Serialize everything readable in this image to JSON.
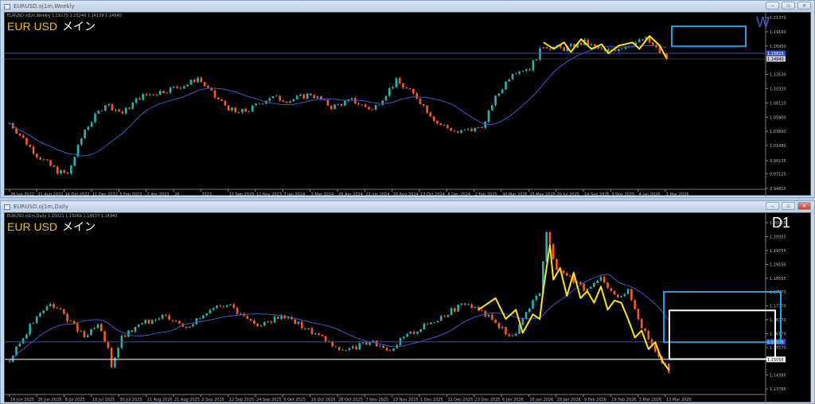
{
  "weekly": {
    "window_title": "EURUSD.oj1m,Weekly",
    "info": "EURUSD.oj1m,Weekly  1.16175 1.15248 1.14139 1.14940",
    "symbol": "EUR USD",
    "label_jp": "メイン",
    "timeframe": "W",
    "price_ticks": [
      "1.21370",
      "1.19160",
      "1.16950",
      "1.12530",
      "1.10320",
      "1.08110",
      "1.05900",
      "1.03690",
      "1.01480",
      "0.99135",
      "0.97125",
      "0.94815"
    ],
    "price_range": [
      0.94815,
      1.2137
    ],
    "hline_price": "1.15815",
    "bid_price": "1.14940",
    "date_ticks": [
      "26 Jun 2022",
      "21 Aug 2022",
      "16 Oct 2022",
      "11 Dec 2022",
      "5 Feb 2023",
      "2 Apr 2023",
      "28",
      "2023",
      "17 Sep 2023",
      "12 Nov 2023",
      "7 Jan 2024",
      "3 Mar 2024",
      "28 Apr 2024",
      "23 Jun 2024",
      "18 Aug 2024",
      "13 Oct 2024",
      "8 Dec 2024",
      "2 Feb 2025",
      "30 Mar 2025",
      "25 May 2025",
      "20 Jul 2025",
      "14 Sep 2025",
      "9 Nov 2025",
      "4 Jan 2026",
      "1 Mar 2026"
    ],
    "keypoints": [
      [
        0,
        1.05
      ],
      [
        8,
        1.0
      ],
      [
        14,
        0.975
      ],
      [
        17,
        0.97
      ],
      [
        22,
        1.04
      ],
      [
        28,
        1.08
      ],
      [
        33,
        1.065
      ],
      [
        38,
        1.09
      ],
      [
        45,
        1.1
      ],
      [
        52,
        1.11
      ],
      [
        55,
        1.12
      ],
      [
        60,
        1.09
      ],
      [
        66,
        1.065
      ],
      [
        70,
        1.07
      ],
      [
        76,
        1.09
      ],
      [
        82,
        1.085
      ],
      [
        88,
        1.095
      ],
      [
        94,
        1.075
      ],
      [
        100,
        1.085
      ],
      [
        106,
        1.07
      ],
      [
        113,
        1.115
      ],
      [
        119,
        1.09
      ],
      [
        125,
        1.05
      ],
      [
        131,
        1.035
      ],
      [
        136,
        1.04
      ],
      [
        139,
        1.05
      ],
      [
        141,
        1.08
      ],
      [
        147,
        1.13
      ],
      [
        152,
        1.135
      ],
      [
        156,
        1.17
      ],
      [
        162,
        1.165
      ],
      [
        168,
        1.175
      ],
      [
        174,
        1.16
      ],
      [
        180,
        1.17
      ],
      [
        186,
        1.18
      ],
      [
        189,
        1.165
      ],
      [
        192,
        1.15
      ]
    ],
    "zigzag": [
      [
        156,
        1.175
      ],
      [
        159,
        1.165
      ],
      [
        162,
        1.175
      ],
      [
        164,
        1.16
      ],
      [
        167,
        1.18
      ],
      [
        170,
        1.165
      ],
      [
        173,
        1.172
      ],
      [
        175,
        1.158
      ],
      [
        178,
        1.17
      ],
      [
        182,
        1.175
      ],
      [
        184,
        1.165
      ],
      [
        187,
        1.185
      ],
      [
        190,
        1.17
      ],
      [
        192,
        1.15
      ]
    ]
  },
  "daily": {
    "window_title": "EURUSD.oj1m,Daily",
    "info": "EURUSD.oj1m,Daily  1.15021 1.15069 1.14937 1.14940",
    "symbol": "EUR USD",
    "label_jp": "メイン",
    "timeframe": "D1",
    "price_ticks": [
      "1.20955",
      "1.20355",
      "1.19755",
      "1.19155",
      "1.18555",
      "1.17970",
      "1.17370",
      "1.16770",
      "1.16170",
      "1.15570",
      "1.14385",
      "1.13785"
    ],
    "price_range": [
      1.13785,
      1.20955
    ],
    "hline_price": "1.15815",
    "white_price": "1.15058",
    "date_ticks": [
      "16 Jun 2025",
      "26 Jun 2025",
      "8 Jul 2025",
      "18 Jul 2025",
      "30 Jul 2025",
      "11 Aug 2025",
      "21 Aug 2025",
      "2 Sep 2025",
      "12 Sep 2025",
      "24 Sep 2025",
      "6 Oct 2025",
      "16 Oct 2025",
      "28 Oct 2025",
      "7 Nov 2025",
      "19 Nov 2025",
      "1 Dec 2025",
      "11 Dec 2025",
      "23 Dec 2025",
      "6 Jan 2026",
      "16 Jan 2026",
      "28 Jan 2026",
      "9 Feb 2026",
      "19 Feb 2026",
      "3 Mar 2026",
      "13 Mar 2026"
    ],
    "keypoints": [
      [
        0,
        1.15
      ],
      [
        6,
        1.165
      ],
      [
        12,
        1.175
      ],
      [
        16,
        1.17
      ],
      [
        22,
        1.16
      ],
      [
        26,
        1.165
      ],
      [
        29,
        1.155
      ],
      [
        30,
        1.148
      ],
      [
        33,
        1.16
      ],
      [
        38,
        1.165
      ],
      [
        45,
        1.17
      ],
      [
        52,
        1.165
      ],
      [
        58,
        1.17
      ],
      [
        64,
        1.175
      ],
      [
        68,
        1.17
      ],
      [
        74,
        1.165
      ],
      [
        80,
        1.17
      ],
      [
        86,
        1.165
      ],
      [
        92,
        1.16
      ],
      [
        96,
        1.155
      ],
      [
        100,
        1.155
      ],
      [
        106,
        1.158
      ],
      [
        112,
        1.155
      ],
      [
        116,
        1.16
      ],
      [
        122,
        1.165
      ],
      [
        128,
        1.17
      ],
      [
        134,
        1.175
      ],
      [
        140,
        1.17
      ],
      [
        144,
        1.165
      ],
      [
        148,
        1.16
      ],
      [
        152,
        1.17
      ],
      [
        156,
        1.18
      ],
      [
        158,
        1.205
      ],
      [
        161,
        1.19
      ],
      [
        166,
        1.185
      ],
      [
        170,
        1.18
      ],
      [
        174,
        1.185
      ],
      [
        178,
        1.178
      ],
      [
        182,
        1.18
      ],
      [
        186,
        1.165
      ],
      [
        190,
        1.155
      ],
      [
        194,
        1.145
      ]
    ],
    "zigzag": [
      [
        138,
        1.172
      ],
      [
        143,
        1.177
      ],
      [
        146,
        1.168
      ],
      [
        149,
        1.172
      ],
      [
        151,
        1.162
      ],
      [
        154,
        1.17
      ],
      [
        156,
        1.168
      ],
      [
        157,
        1.18
      ],
      [
        159,
        1.2
      ],
      [
        160,
        1.185
      ],
      [
        162,
        1.19
      ],
      [
        164,
        1.178
      ],
      [
        166,
        1.188
      ],
      [
        168,
        1.177
      ],
      [
        170,
        1.18
      ],
      [
        172,
        1.175
      ],
      [
        174,
        1.182
      ],
      [
        176,
        1.172
      ],
      [
        178,
        1.176
      ],
      [
        180,
        1.175
      ],
      [
        182,
        1.168
      ],
      [
        184,
        1.16
      ],
      [
        186,
        1.163
      ],
      [
        188,
        1.155
      ],
      [
        190,
        1.158
      ],
      [
        192,
        1.15
      ],
      [
        194,
        1.146
      ]
    ]
  },
  "colors": {
    "bull": "#1fb7b0",
    "bear": "#ff5a1e",
    "ma": "#3a59d6",
    "zig": "#ffe800",
    "box_blue": "#1fa0e0",
    "hline": "#3350c8"
  }
}
